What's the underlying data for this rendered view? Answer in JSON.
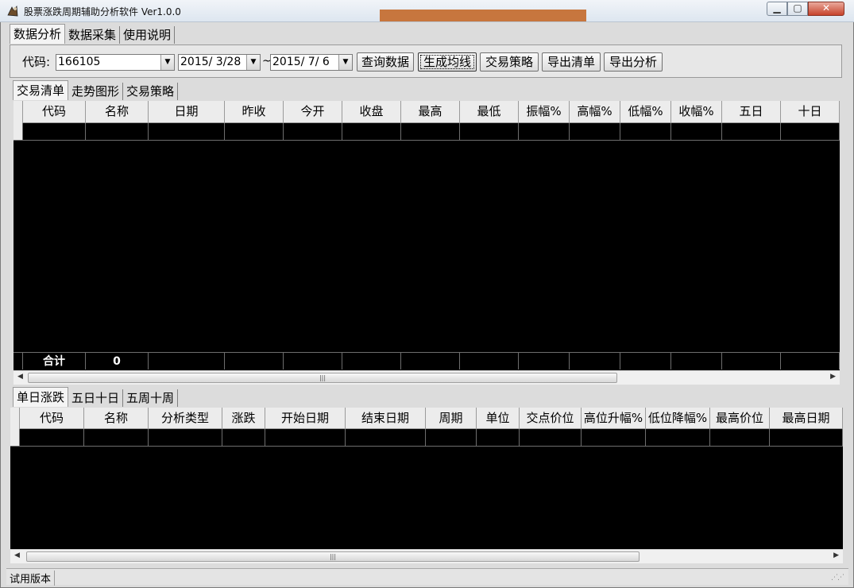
{
  "window": {
    "title": "股票涨跌周期辅助分析软件 Ver1.0.0",
    "close_glyph": "✕",
    "min_glyph": "▁",
    "max_glyph": "▢"
  },
  "menu_tabs": [
    "数据分析",
    "数据采集",
    "使用说明"
  ],
  "toolbar": {
    "code_label": "代码:",
    "code_value": "166105",
    "date_from": "2015/ 3/28",
    "date_sep": "~",
    "date_to": "2015/ 7/ 6",
    "buttons": [
      "查询数据",
      "生成均线",
      "交易策略",
      "导出清单",
      "导出分析"
    ]
  },
  "upper_tabs": [
    "交易清单",
    "走势图形",
    "交易策略"
  ],
  "upper_grid": {
    "columns": [
      "代码",
      "名称",
      "日期",
      "昨收",
      "今开",
      "收盘",
      "最高",
      "最低",
      "振幅%",
      "高幅%",
      "低幅%",
      "收幅%",
      "五日",
      "十日"
    ],
    "footer_label": "合计",
    "footer_count": "0"
  },
  "lower_tabs": [
    "单日涨跌",
    "五日十日",
    "五周十周"
  ],
  "lower_grid": {
    "columns": [
      "代码",
      "名称",
      "分析类型",
      "涨跌",
      "开始日期",
      "结束日期",
      "周期",
      "单位",
      "交点价位",
      "高位升幅%",
      "低位降幅%",
      "最高价位",
      "最高日期"
    ]
  },
  "status": {
    "text": "试用版本"
  },
  "colors": {
    "grid_bg": "#000000",
    "header_bg": "#ececec",
    "title_deco": "#c7763e"
  }
}
